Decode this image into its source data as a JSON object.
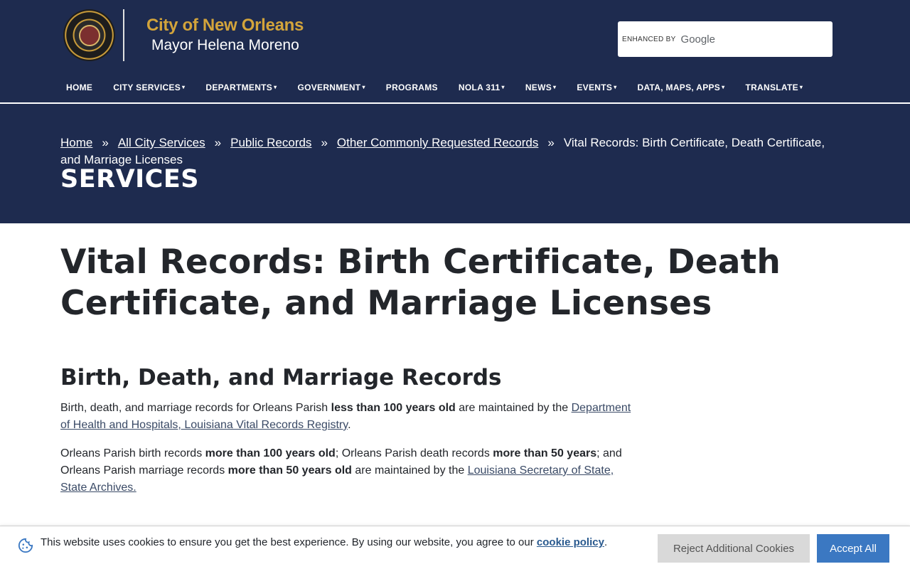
{
  "header": {
    "title": "City of New Orleans",
    "subtitle": "Mayor Helena Moreno",
    "search": {
      "enhanced_label": "ENHANCED BY",
      "provider": "Google"
    }
  },
  "nav": {
    "items": [
      {
        "label": "HOME",
        "dropdown": false
      },
      {
        "label": "CITY SERVICES",
        "dropdown": true
      },
      {
        "label": "DEPARTMENTS",
        "dropdown": true
      },
      {
        "label": "GOVERNMENT",
        "dropdown": true
      },
      {
        "label": "PROGRAMS",
        "dropdown": false
      },
      {
        "label": "NOLA 311",
        "dropdown": true
      },
      {
        "label": "NEWS",
        "dropdown": true
      },
      {
        "label": "EVENTS",
        "dropdown": true
      },
      {
        "label": "DATA, MAPS, APPS",
        "dropdown": true
      },
      {
        "label": "TRANSLATE",
        "dropdown": true
      }
    ]
  },
  "breadcrumb": {
    "links": [
      "Home",
      "All City Services",
      "Public Records",
      "Other Commonly Requested Records"
    ],
    "separator": "»",
    "current": "Vital Records: Birth Certificate, Death Certificate, and Marriage Licenses"
  },
  "hero": {
    "label": "SERVICES"
  },
  "main": {
    "title": "Vital Records: Birth Certificate, Death Certificate, and Marriage Licenses",
    "section_title": "Birth, Death, and Marriage Records",
    "p1": {
      "t1": "Birth, death, and marriage records for Orleans Parish ",
      "b1": "less than 100 years old",
      "t2": " are maintained by the ",
      "link": "Department of Health and Hospitals, Louisiana Vital Records Registry",
      "t3": "."
    },
    "p2": {
      "t1": "Orleans Parish birth records ",
      "b1": "more than 100 years old",
      "t2": "; Orleans Parish death records ",
      "b2": "more than 50 years",
      "t3": "; and Orleans Parish marriage records ",
      "b3": "more than 50 years old",
      "t4": " are maintained by the ",
      "link": "Louisiana Secretary of State, State Archives."
    }
  },
  "cookie": {
    "text": "This website uses cookies to ensure you get the best experience. By using our website, you agree to our ",
    "link": "cookie policy",
    "end": ".",
    "reject_label": "Reject Additional Cookies",
    "accept_label": "Accept All"
  },
  "colors": {
    "header_bg": "#1e2b4f",
    "brand_gold": "#d3a43b",
    "accept_blue": "#3b78c2"
  }
}
